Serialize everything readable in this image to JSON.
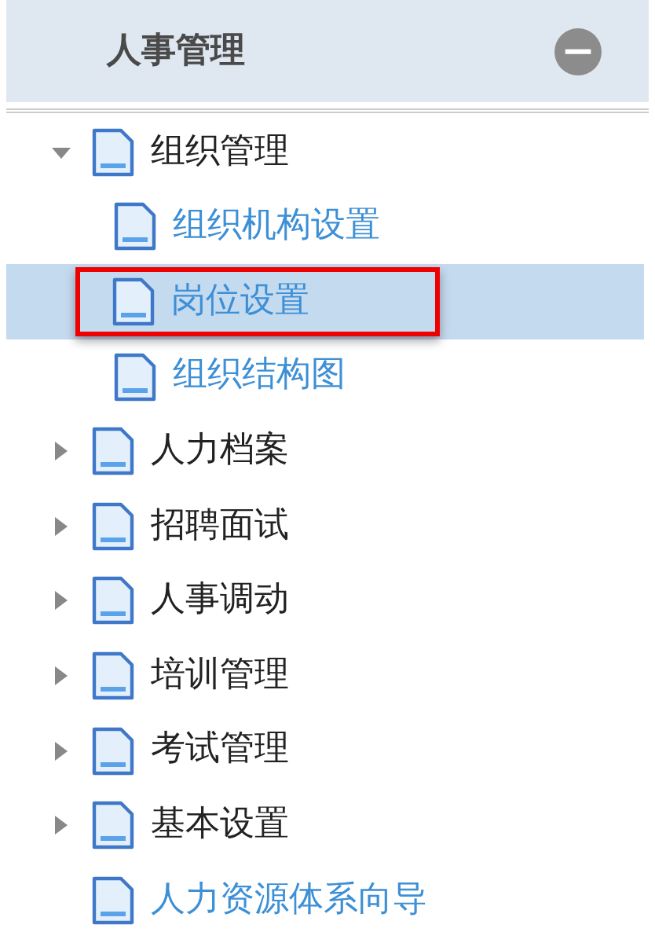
{
  "panel": {
    "title": "人事管理",
    "collapse_icon": "−"
  },
  "tree": [
    {
      "label": "组织管理",
      "kind": "folder",
      "expanded": true,
      "selected": false,
      "children": [
        {
          "label": "组织机构设置",
          "kind": "page",
          "selected": false,
          "outlined": false
        },
        {
          "label": "岗位设置",
          "kind": "page",
          "selected": true,
          "outlined": true
        },
        {
          "label": "组织结构图",
          "kind": "page",
          "selected": false,
          "outlined": false
        }
      ]
    },
    {
      "label": "人力档案",
      "kind": "folder",
      "expanded": false,
      "selected": false
    },
    {
      "label": "招聘面试",
      "kind": "folder",
      "expanded": false,
      "selected": false
    },
    {
      "label": "人事调动",
      "kind": "folder",
      "expanded": false,
      "selected": false
    },
    {
      "label": "培训管理",
      "kind": "folder",
      "expanded": false,
      "selected": false
    },
    {
      "label": "考试管理",
      "kind": "folder",
      "expanded": false,
      "selected": false
    },
    {
      "label": "基本设置",
      "kind": "folder",
      "expanded": false,
      "selected": false
    },
    {
      "label": "人力资源体系向导",
      "kind": "page",
      "selected": false
    }
  ]
}
